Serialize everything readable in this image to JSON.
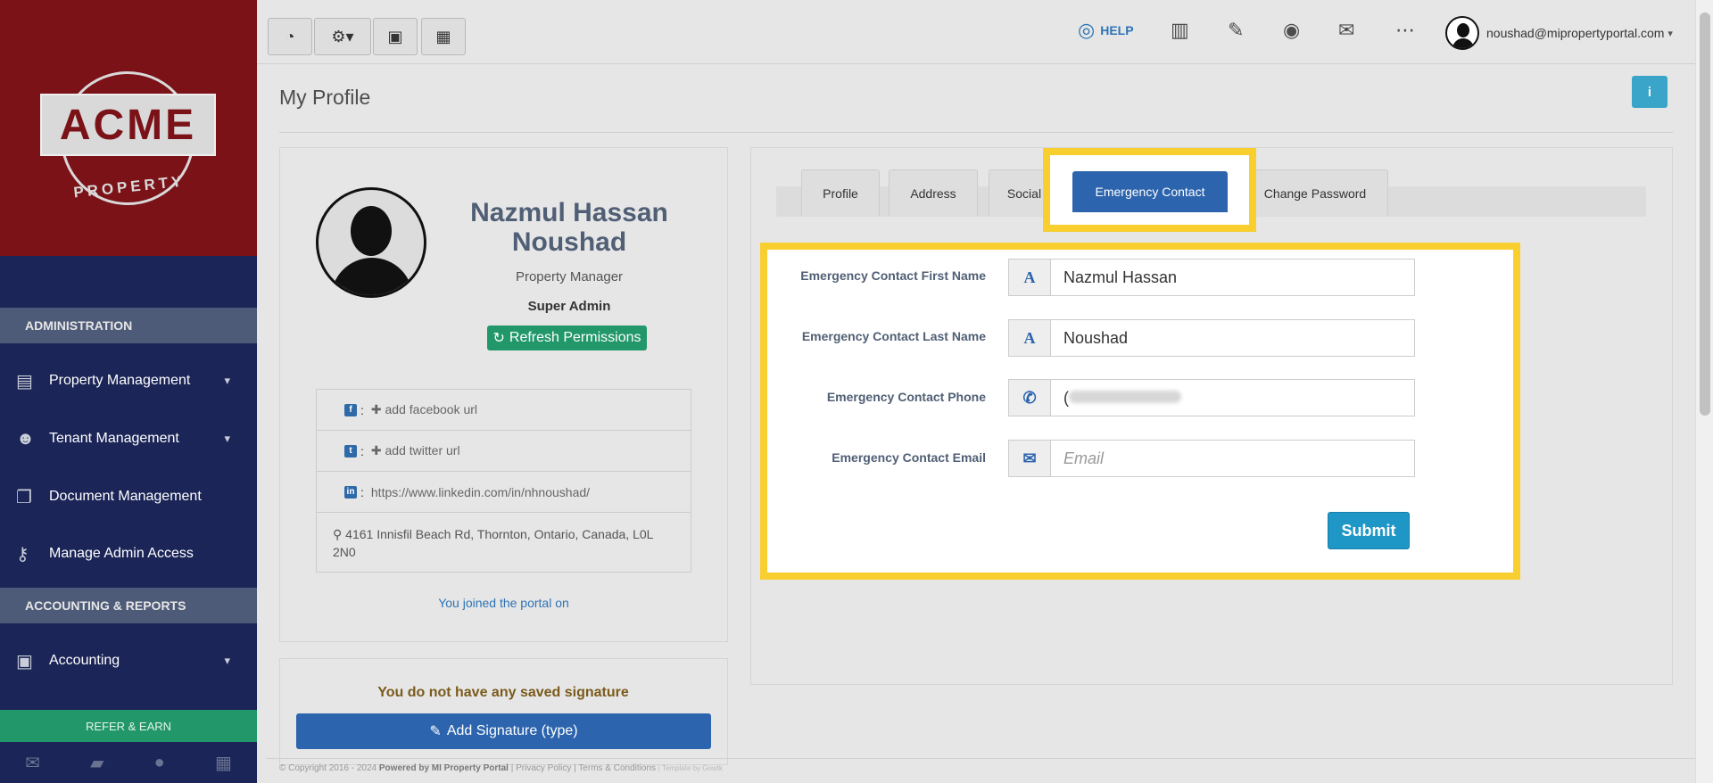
{
  "sidebar": {
    "logo_text": "ACME",
    "logo_sub": "PROPERTY",
    "section_admin": "ADMINISTRATION",
    "items": [
      {
        "label": "Property Management",
        "icon": "building-icon"
      },
      {
        "label": "Tenant Management",
        "icon": "users-icon"
      },
      {
        "label": "Document Management",
        "icon": "documents-icon"
      },
      {
        "label": "Manage Admin Access",
        "icon": "key-icon"
      }
    ],
    "section_accounting": "ACCOUNTING & REPORTS",
    "accounting_label": "Accounting",
    "refer_label": "REFER & EARN"
  },
  "topbar": {
    "help_label": "HELP",
    "user_email": "noushad@mipropertyportal.com"
  },
  "page": {
    "title": "My Profile"
  },
  "profile": {
    "first_name_line": "Nazmul Hassan",
    "last_name_line": "Noushad",
    "role": "Property Manager",
    "access_level": "Super Admin",
    "refresh_label": "Refresh Permissions",
    "facebook": "add facebook url",
    "twitter": "add twitter url",
    "linkedin": "https://www.linkedin.com/in/nhnoushad/",
    "address": "4161 Innisfil Beach Rd, Thornton, Ontario, Canada, L0L 2N0",
    "joined": "You joined the portal on",
    "signature_message": "You do not have any saved signature",
    "signature_button": "Add Signature (type)"
  },
  "tabs": [
    "Profile",
    "Address",
    "Social",
    "Emergency Contact",
    "Change Password"
  ],
  "form": {
    "first_name_label": "Emergency Contact First Name",
    "first_name_value": "Nazmul Hassan",
    "last_name_label": "Emergency Contact Last Name",
    "last_name_value": "Noushad",
    "phone_label": "Emergency Contact Phone",
    "phone_value": "(",
    "email_label": "Emergency Contact Email",
    "email_placeholder": "Email",
    "submit_label": "Submit"
  },
  "footer": {
    "copyright": "© Copyright 2016 - 2024",
    "powered": "Powered by MI Property Portal",
    "links": "| Privacy Policy | Terms & Conditions",
    "template": "| Template by Gowtk"
  },
  "colors": {
    "sidebar_bg": "#1b2557",
    "logo_bg": "#7a1218",
    "accent_blue": "#2c64ad",
    "accent_green": "#21976a",
    "highlight": "#f8cf2f"
  }
}
